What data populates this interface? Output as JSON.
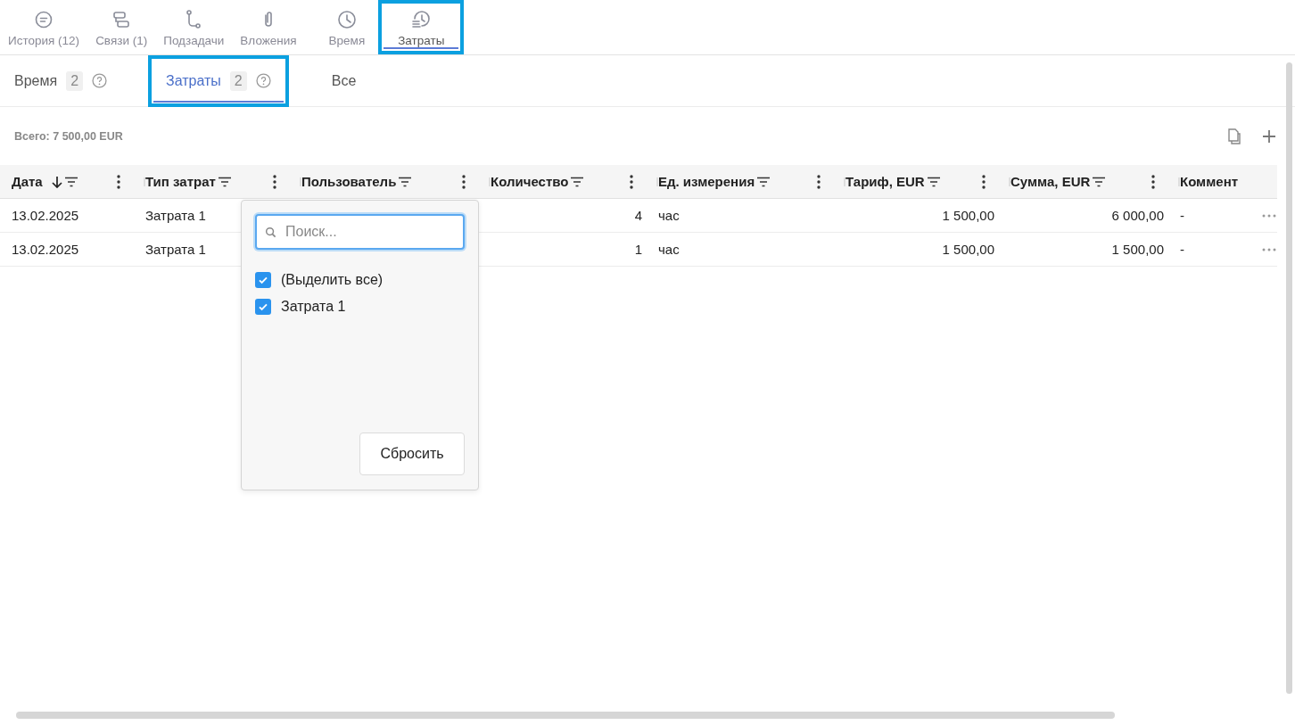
{
  "top_tabs": [
    {
      "label": "История (12)",
      "selected": false,
      "highlighted": false
    },
    {
      "label": "Связи (1)",
      "selected": false,
      "highlighted": false
    },
    {
      "label": "Подзадачи",
      "selected": false,
      "highlighted": false
    },
    {
      "label": "Вложения",
      "selected": false,
      "highlighted": false
    },
    {
      "label": "Время",
      "selected": false,
      "highlighted": false
    },
    {
      "label": "Затраты",
      "selected": true,
      "highlighted": true
    }
  ],
  "sub_tabs": [
    {
      "label": "Время",
      "count": "2",
      "help": true,
      "selected": false,
      "highlighted": false
    },
    {
      "label": "Затраты",
      "count": "2",
      "help": true,
      "selected": true,
      "highlighted": true
    },
    {
      "label": "Все",
      "help": false,
      "selected": false,
      "highlighted": false
    }
  ],
  "total": "Всего: 7 500,00 EUR",
  "table": {
    "columns": [
      {
        "label": "Дата",
        "sorted": true,
        "filter": true,
        "menu": true
      },
      {
        "label": "Тип затрат",
        "sorted": false,
        "filter": true,
        "menu": true
      },
      {
        "label": "Пользователь",
        "sorted": false,
        "filter": true,
        "menu": true
      },
      {
        "label": "Количество",
        "sorted": false,
        "filter": true,
        "menu": true
      },
      {
        "label": "Ед. измерения",
        "sorted": false,
        "filter": true,
        "menu": true
      },
      {
        "label": "Тариф, EUR",
        "sorted": false,
        "filter": true,
        "menu": true
      },
      {
        "label": "Сумма, EUR",
        "sorted": false,
        "filter": true,
        "menu": true
      },
      {
        "label": "Коммент",
        "sorted": false,
        "filter": false,
        "menu": false
      }
    ],
    "rows": [
      {
        "cells": [
          "13.02.2025",
          "Затрата 1",
          null,
          "4",
          "час",
          "1 500,00",
          "6 000,00",
          "-"
        ]
      },
      {
        "cells": [
          "13.02.2025",
          "Затрата 1",
          null,
          "1",
          "час",
          "1 500,00",
          "1 500,00",
          "-"
        ]
      }
    ]
  },
  "filter_popup": {
    "search": {
      "placeholder": "Поиск..."
    },
    "options": [
      {
        "label": "(Выделить все)",
        "checked": true
      },
      {
        "label": "Затрата 1",
        "checked": true
      }
    ],
    "reset_button": "Сбросить"
  }
}
